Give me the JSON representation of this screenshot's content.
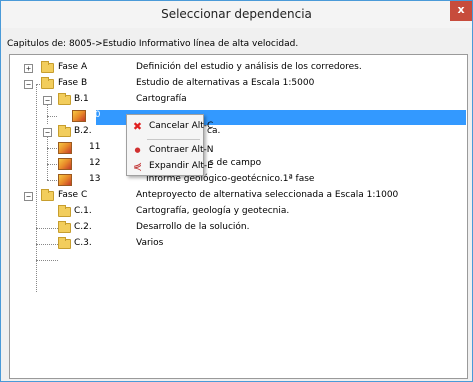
{
  "window": {
    "title": "Seleccionar dependencia",
    "close_label": "x"
  },
  "breadcrumb": "Capitulos de: 8005->Estudio Informativo línea de alta velocidad.",
  "tree": {
    "rows": [
      {
        "code": "Fase A",
        "desc": "Definición del estudio y análisis de los corredores."
      },
      {
        "code": "Fase B",
        "desc": "Estudio de alternativas a Escala 1:5000"
      },
      {
        "code": "B.1",
        "desc": "Cartografía"
      },
      {
        "code": "10",
        "desc": ""
      },
      {
        "code": "B.2.",
        "desc": "ca."
      },
      {
        "code": "11",
        "desc": "s de campo"
      },
      {
        "code": "12",
        "desc": ""
      },
      {
        "code": "13",
        "desc": "Informe geológico-geotécnico.1ª fase"
      },
      {
        "code": "Fase C",
        "desc": "Anteproyecto de alternativa seleccionada a Escala 1:1000"
      },
      {
        "code": "C.1.",
        "desc": "Cartografía, geología y geotecnia."
      },
      {
        "code": "C.2.",
        "desc": "Desarrollo de la solución."
      },
      {
        "code": "C.3.",
        "desc": "Varios"
      }
    ]
  },
  "context_menu": {
    "items": [
      {
        "label": "Cancelar",
        "shortcut": "Alt-C",
        "icon": "red-x-icon"
      },
      {
        "label": "Contraer",
        "shortcut": "Alt-N",
        "icon": "collapse-icon"
      },
      {
        "label": "Expandir",
        "shortcut": "Alt-E",
        "icon": "expand-icon"
      }
    ]
  }
}
